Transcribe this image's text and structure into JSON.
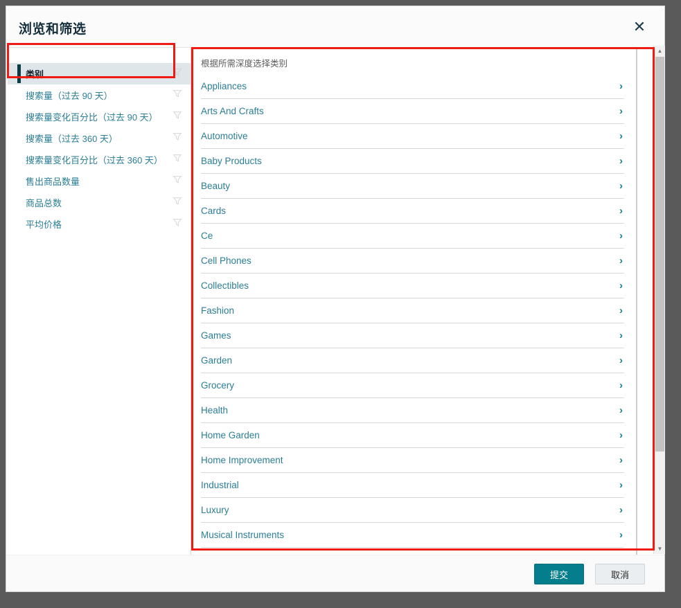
{
  "dialog": {
    "title": "浏览和筛选",
    "close_label": "✕",
    "close_icon": "close-icon"
  },
  "sidebar": {
    "items": [
      {
        "label": "类别",
        "selected": true,
        "filter_icon": "filter-funnel-icon"
      },
      {
        "label": "搜索量（过去 90 天）",
        "selected": false,
        "filter_icon": "filter-funnel-icon"
      },
      {
        "label": "搜索量变化百分比（过去 90 天）",
        "selected": false,
        "filter_icon": "filter-funnel-icon"
      },
      {
        "label": "搜索量（过去 360 天）",
        "selected": false,
        "filter_icon": "filter-funnel-icon"
      },
      {
        "label": "搜索量变化百分比（过去 360 天）",
        "selected": false,
        "filter_icon": "filter-funnel-icon"
      },
      {
        "label": "售出商品数量",
        "selected": false,
        "filter_icon": "filter-funnel-icon"
      },
      {
        "label": "商品总数",
        "selected": false,
        "filter_icon": "filter-funnel-icon"
      },
      {
        "label": "平均价格",
        "selected": false,
        "filter_icon": "filter-funnel-icon"
      }
    ]
  },
  "category_panel": {
    "hint": "根据所需深度选择类别",
    "chevron_icon": "chevron-right-icon",
    "items": [
      {
        "label": "Appliances"
      },
      {
        "label": "Arts And Crafts"
      },
      {
        "label": "Automotive"
      },
      {
        "label": "Baby Products"
      },
      {
        "label": "Beauty"
      },
      {
        "label": "Cards"
      },
      {
        "label": "Ce"
      },
      {
        "label": "Cell Phones"
      },
      {
        "label": "Collectibles"
      },
      {
        "label": "Fashion"
      },
      {
        "label": "Games"
      },
      {
        "label": "Garden"
      },
      {
        "label": "Grocery"
      },
      {
        "label": "Health"
      },
      {
        "label": "Home Garden"
      },
      {
        "label": "Home Improvement"
      },
      {
        "label": "Industrial"
      },
      {
        "label": "Luxury"
      },
      {
        "label": "Musical Instruments"
      }
    ]
  },
  "footer": {
    "submit_label": "提交",
    "cancel_label": "取消"
  },
  "scrollbar": {
    "up_glyph": "▲",
    "down_glyph": "▼"
  },
  "colors": {
    "accent_teal": "#047d8c",
    "link_teal": "#2a7e95",
    "selected_bar": "#0d3b45",
    "selected_bg": "#dfe6e9",
    "annotation_red": "#ef1b12",
    "backdrop": "#5a5a5a",
    "title_navy": "#142e3c"
  }
}
